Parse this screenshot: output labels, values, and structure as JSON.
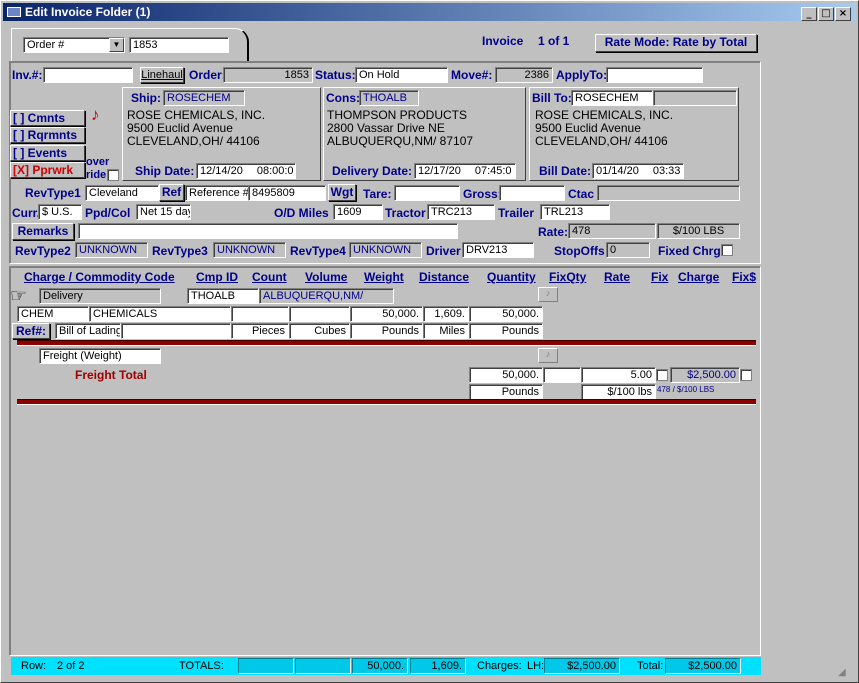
{
  "window": {
    "title": "Edit Invoice Folder (1)"
  },
  "top": {
    "lookup_by": "Order #",
    "lookup_value": "1853",
    "invoice_label": "Invoice",
    "invoice_pos": "1 of 1",
    "rate_mode": "Rate Mode: Rate by Total"
  },
  "header": {
    "inv_label": "Inv.#:",
    "inv_value": "",
    "linehaul": "Linehaul",
    "order_label": "Order:",
    "order_value": "1853",
    "status_label": "Status:",
    "status_value": "On Hold",
    "move_label": "Move#:",
    "move_value": "2386",
    "applyto_label": "ApplyTo:",
    "applyto_value": ""
  },
  "side_buttons": {
    "cmnts": "[ ] Cmnts",
    "rqrmnts": "[ ] Rqrmnts",
    "events": "[ ] Events",
    "pprwrk": "[X] Pprwrk",
    "override": "over ride"
  },
  "ship": {
    "label": "Ship:",
    "code": "ROSECHEM",
    "name": "ROSE CHEMICALS, INC.",
    "addr": "9500 Euclid Avenue",
    "city": "CLEVELAND,OH/ 44106",
    "date_label": "Ship Date:",
    "date": "12/14/20",
    "time": "08:00:0"
  },
  "cons": {
    "label": "Cons:",
    "code": "THOALB",
    "name": "THOMPSON PRODUCTS",
    "addr": "2800 Vassar Drive NE",
    "city": "ALBUQUERQU,NM/ 87107",
    "date_label": "Delivery Date:",
    "date": "12/17/20",
    "time": "07:45:0"
  },
  "billto": {
    "label": "Bill To:",
    "code": "ROSECHEM",
    "extra": "",
    "name": "ROSE CHEMICALS, INC.",
    "addr": "9500 Euclid Avenue",
    "city": "CLEVELAND,OH/ 44106",
    "date_label": "Bill Date:",
    "date": "01/14/20",
    "time": "03:33"
  },
  "row1": {
    "revtype1_label": "RevType1",
    "revtype1": "Cleveland",
    "ref_btn": "Ref",
    "ref_type": "Reference #",
    "ref_value": "8495809",
    "wgt_btn": "Wgt",
    "tare_label": "Tare:",
    "tare": "",
    "gross_label": "Gross:",
    "gross": "",
    "ctac_label": "Ctac",
    "ctac": ""
  },
  "row2": {
    "curr_label": "Curr.",
    "curr": "$ U.S.",
    "ppd_label": "Ppd/Col",
    "ppd": "Net 15 day",
    "od_label": "O/D Miles",
    "od": "1609",
    "tractor_label": "Tractor",
    "tractor": "TRC213",
    "trailer_label": "Trailer",
    "trailer": "TRL213"
  },
  "row3": {
    "remarks_btn": "Remarks",
    "remarks": "",
    "rate_label": "Rate:",
    "rate": "478",
    "rate_unit": "$/100 LBS"
  },
  "row4": {
    "revtype2_label": "RevType2",
    "revtype2": "UNKNOWN",
    "revtype3_label": "RevType3",
    "revtype3": "UNKNOWN",
    "revtype4_label": "RevType4",
    "revtype4": "UNKNOWN",
    "driver_label": "Driver",
    "driver": "DRV213",
    "stopoffs_label": "StopOffs",
    "stopoffs": "0",
    "fixed_label": "Fixed Chrg"
  },
  "grid_headers": [
    "Charge / Commodity Code",
    "Cmp ID",
    "Count",
    "Volume",
    "Weight",
    "Distance",
    "Quantity",
    "FixQty",
    "Rate",
    "Fix",
    "Charge",
    "Fix$"
  ],
  "delivery": {
    "type": "Delivery",
    "cmp": "THOALB",
    "city": "ALBUQUERQU,NM/",
    "code": "CHEM",
    "desc": "CHEMICALS",
    "count": "",
    "volume": "",
    "weight": "50,000.",
    "distance": "1,609.",
    "quantity": "50,000.",
    "ref_btn": "Ref#:",
    "ref_type": "Bill of Lading",
    "ref_value": "",
    "u_count": "Pieces",
    "u_volume": "Cubes",
    "u_weight": "Pounds",
    "u_distance": "Miles",
    "u_quantity": "Pounds"
  },
  "freight": {
    "type": "Freight (Weight)",
    "total_label": "Freight Total",
    "qty": "50,000.",
    "fixqty": "",
    "rate": "5.00",
    "charge": "$2,500.00",
    "qty_unit": "Pounds",
    "rate_unit": "$/100 lbs",
    "rate_note": "478 / $/100 LBS"
  },
  "status": {
    "row_label": "Row:",
    "row": "2 of 2",
    "totals_label": "TOTALS:",
    "t1": "",
    "t2": "",
    "weight": "50,000.",
    "distance": "1,609.",
    "charges_label": "Charges:",
    "lh_label": "LH:",
    "lh": "$2,500.00",
    "total_label": "Total:",
    "total": "$2,500.00"
  },
  "colors": {
    "accent": "#00008b",
    "title_start": "#0a246a",
    "red": "#cc0000",
    "status_bar": "#00e0ff"
  }
}
